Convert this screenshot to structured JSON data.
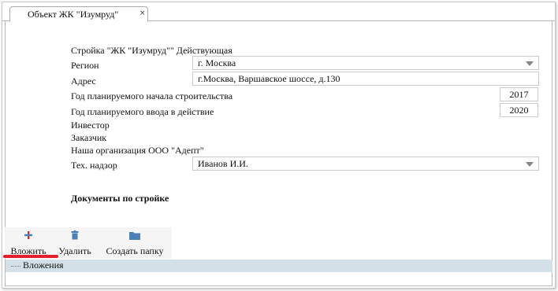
{
  "tab": {
    "title": "Объект ЖК \"Изумруд\"",
    "close": "×"
  },
  "header": {
    "line": "Стройка \"ЖК \"Изумруд\"\" Действующая"
  },
  "form": {
    "region_label": "Регион",
    "region_value": "г. Москва",
    "address_label": "Адрес",
    "address_value": "г.Москва, Варшавское шоссе, д.130",
    "start_year_label": "Год планируемого начала строительства",
    "start_year_value": "2017",
    "commission_year_label": "Год планируемого ввода в действие",
    "commission_year_value": "2020",
    "investor_label": "Инвестор",
    "customer_label": "Заказчик",
    "our_org_label": "Наша организация ООО \"Адепт\"",
    "supervision_label": "Тех. надзор",
    "supervision_value": "Иванов И.И."
  },
  "documents": {
    "title": "Документы по стройке"
  },
  "toolbar": {
    "attach_label": "Вложить",
    "delete_label": "Удалить",
    "create_folder_label": "Создать папку"
  },
  "tree": {
    "root_label": "Вложения"
  },
  "colors": {
    "accent_underline": "#e3212e",
    "tree_bar": "#d3e0e7",
    "icon_blue": "#4a7fb8"
  }
}
